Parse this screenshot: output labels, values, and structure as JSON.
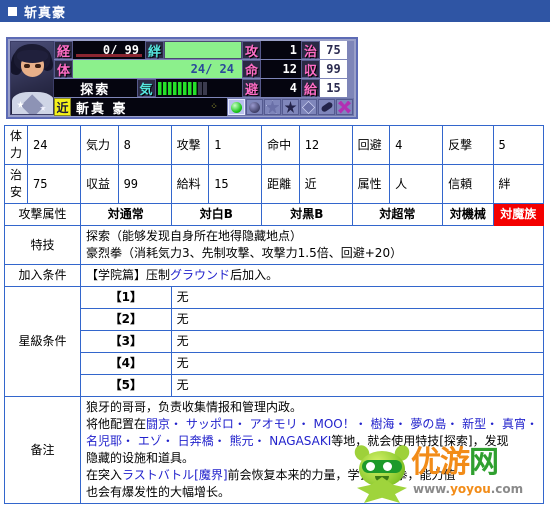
{
  "window": {
    "title": "斩真豪",
    "icon": "square-bullet-icon"
  },
  "status_panel": {
    "portrait_alt": "character-portrait",
    "exp": {
      "label": "経",
      "value": "0/ 99"
    },
    "bond": {
      "label": "絆",
      "value": ""
    },
    "hp": {
      "label": "体",
      "value": "24/ 24"
    },
    "command": {
      "label": "探索"
    },
    "ki": {
      "label": "気",
      "filled": 8,
      "total": 10
    },
    "right_stats": [
      {
        "label": "攻",
        "value": "1",
        "label2": "治",
        "value2": "75"
      },
      {
        "label": "命",
        "value": "12",
        "label2": "収",
        "value2": "99"
      },
      {
        "label": "避",
        "value": "4",
        "label2": "給",
        "value2": "15"
      }
    ],
    "name_row": {
      "tag": "近",
      "name": "斬真 豪"
    },
    "icons": [
      "green-orb-icon",
      "dark-orb-icon",
      "outline-star-icon",
      "filled-star-icon",
      "diamond-icon",
      "bone-icon",
      "x-cross-icon"
    ]
  },
  "stats": {
    "row1": [
      {
        "label": "体力",
        "value": "24"
      },
      {
        "label": "気力",
        "value": "8"
      },
      {
        "label": "攻撃",
        "value": "1"
      },
      {
        "label": "命中",
        "value": "12"
      },
      {
        "label": "回避",
        "value": "4"
      },
      {
        "label": "反撃",
        "value": "5"
      }
    ],
    "row2": [
      {
        "label": "治安",
        "value": "75"
      },
      {
        "label": "収益",
        "value": "99"
      },
      {
        "label": "給料",
        "value": "15"
      },
      {
        "label": "距離",
        "value": "近"
      },
      {
        "label": "属性",
        "value": "人"
      },
      {
        "label": "信頼",
        "value": "絆"
      }
    ]
  },
  "attack_attr": {
    "label": "攻撃属性",
    "cells": [
      {
        "text": "対通常",
        "highlight": false
      },
      {
        "text": "対白B",
        "highlight": false
      },
      {
        "text": "対黒B",
        "highlight": false
      },
      {
        "text": "対超常",
        "highlight": false
      },
      {
        "text": "対機械",
        "highlight": false
      },
      {
        "text": "対魔族",
        "highlight": true
      }
    ],
    "highlight_color": "#f40000"
  },
  "special": {
    "label": "特技",
    "lines": [
      "探索（能够发现自身所在地得隐藏地点）",
      "豪烈拳（消耗気力3、先制攻撃、攻撃力1.5倍、回避+20）"
    ]
  },
  "join": {
    "label": "加入条件",
    "prefix": "【学院篇】压制",
    "blue": "グラウンド",
    "suffix": "后加入。"
  },
  "star_conditions": {
    "label": "星級条件",
    "rows": [
      {
        "index": "【1】",
        "text": "无"
      },
      {
        "index": "【2】",
        "text": "无"
      },
      {
        "index": "【3】",
        "text": "无"
      },
      {
        "index": "【4】",
        "text": "无"
      },
      {
        "index": "【5】",
        "text": "无"
      }
    ]
  },
  "remarks": {
    "label": "备注",
    "line1": "狼牙的哥哥，负责收集情报和管理内政。",
    "line2_prefix": "将他配置在",
    "line2_blue": "闘京・ サッポロ・ アオモリ・ MOO！・ 樹海・ 夢の島・ 新型・ 真宵・",
    "line3_blue": "名児耶・ エゾ・ 日奔橋・ 熊元・ NAGASAKI",
    "line3_suffix": "等地，就会使用特技[探索]，发现",
    "line4": "隐藏的设施和道具。",
    "line5_prefix": "在突入",
    "line5_blue": "ラストバトル",
    "line5_blue2": "[魔界]",
    "line5_suffix": "前会恢复本来的力量，学会豪烈拳，能力值",
    "line6": "也会有爆发性的大幅增长。"
  },
  "watermark": {
    "brand_a": "优",
    "brand_b": "游",
    "brand_c": "网",
    "url_a": "www.",
    "url_b": "yoyou",
    "url_c": ".com",
    "mascot": "green-mascot-icon"
  }
}
